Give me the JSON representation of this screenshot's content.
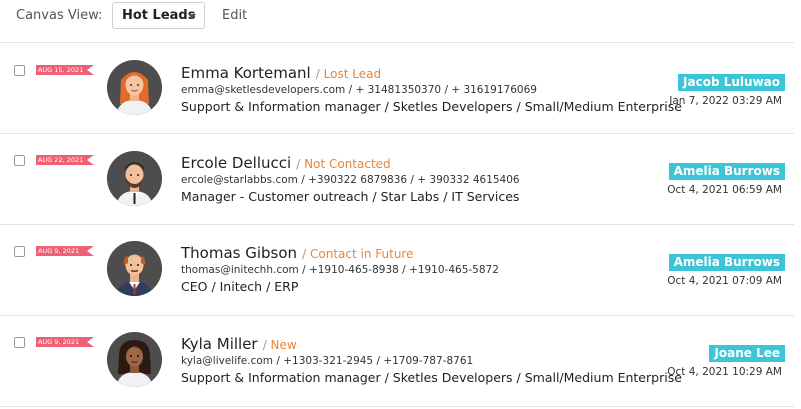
{
  "toolbar": {
    "canvas_label": "Canvas View:",
    "selected_view": "Hot Leads",
    "edit_label": "Edit"
  },
  "colors": {
    "status": "#e8863a",
    "owner_badge": "#3cc5d6",
    "date_tag": "#ef6072"
  },
  "leads": [
    {
      "date": "AUG 15, 2021",
      "name": "Emma Kortemanl",
      "status": "Lost Lead",
      "contact": "emma@sketlesdevelopers.com / + 31481350370 / + 31619176069",
      "company": "Support & Information manager / Sketles Developers / Small/Medium Enterprise",
      "owner": "Jacob Luluwao",
      "timestamp": "Jan 7, 2022 03:29 AM",
      "avatar": "woman-orange-hair-avatar"
    },
    {
      "date": "AUG 22, 2021",
      "name": "Ercole Dellucci",
      "status": "Not Contacted",
      "contact": "ercole@starlabbs.com / +390322 6879836 / + 390332 4615406",
      "company": "Manager - Customer outreach / Star Labs / IT Services",
      "owner": "Amelia Burrows",
      "timestamp": "Oct 4, 2021 06:59 AM",
      "avatar": "man-beard-avatar"
    },
    {
      "date": "AUG 9, 2021",
      "name": "Thomas Gibson",
      "status": "Contact in Future",
      "contact": "thomas@initechh.com / +1910-465-8938 / +1910-465-5872",
      "company": "CEO / Initech / ERP",
      "owner": "Amelia Burrows",
      "timestamp": "Oct 4, 2021 07:09 AM",
      "avatar": "man-balding-avatar"
    },
    {
      "date": "AUG 9, 2021",
      "name": "Kyla Miller",
      "status": "New",
      "contact": "kyla@livelife.com / +1303-321-2945 / +1709-787-8761",
      "company": "Support & Information manager / Sketles Developers / Small/Medium Enterprise",
      "owner": "Joane Lee",
      "timestamp": "Oct 4, 2021 10:29 AM",
      "avatar": "woman-curly-hair-avatar"
    }
  ]
}
